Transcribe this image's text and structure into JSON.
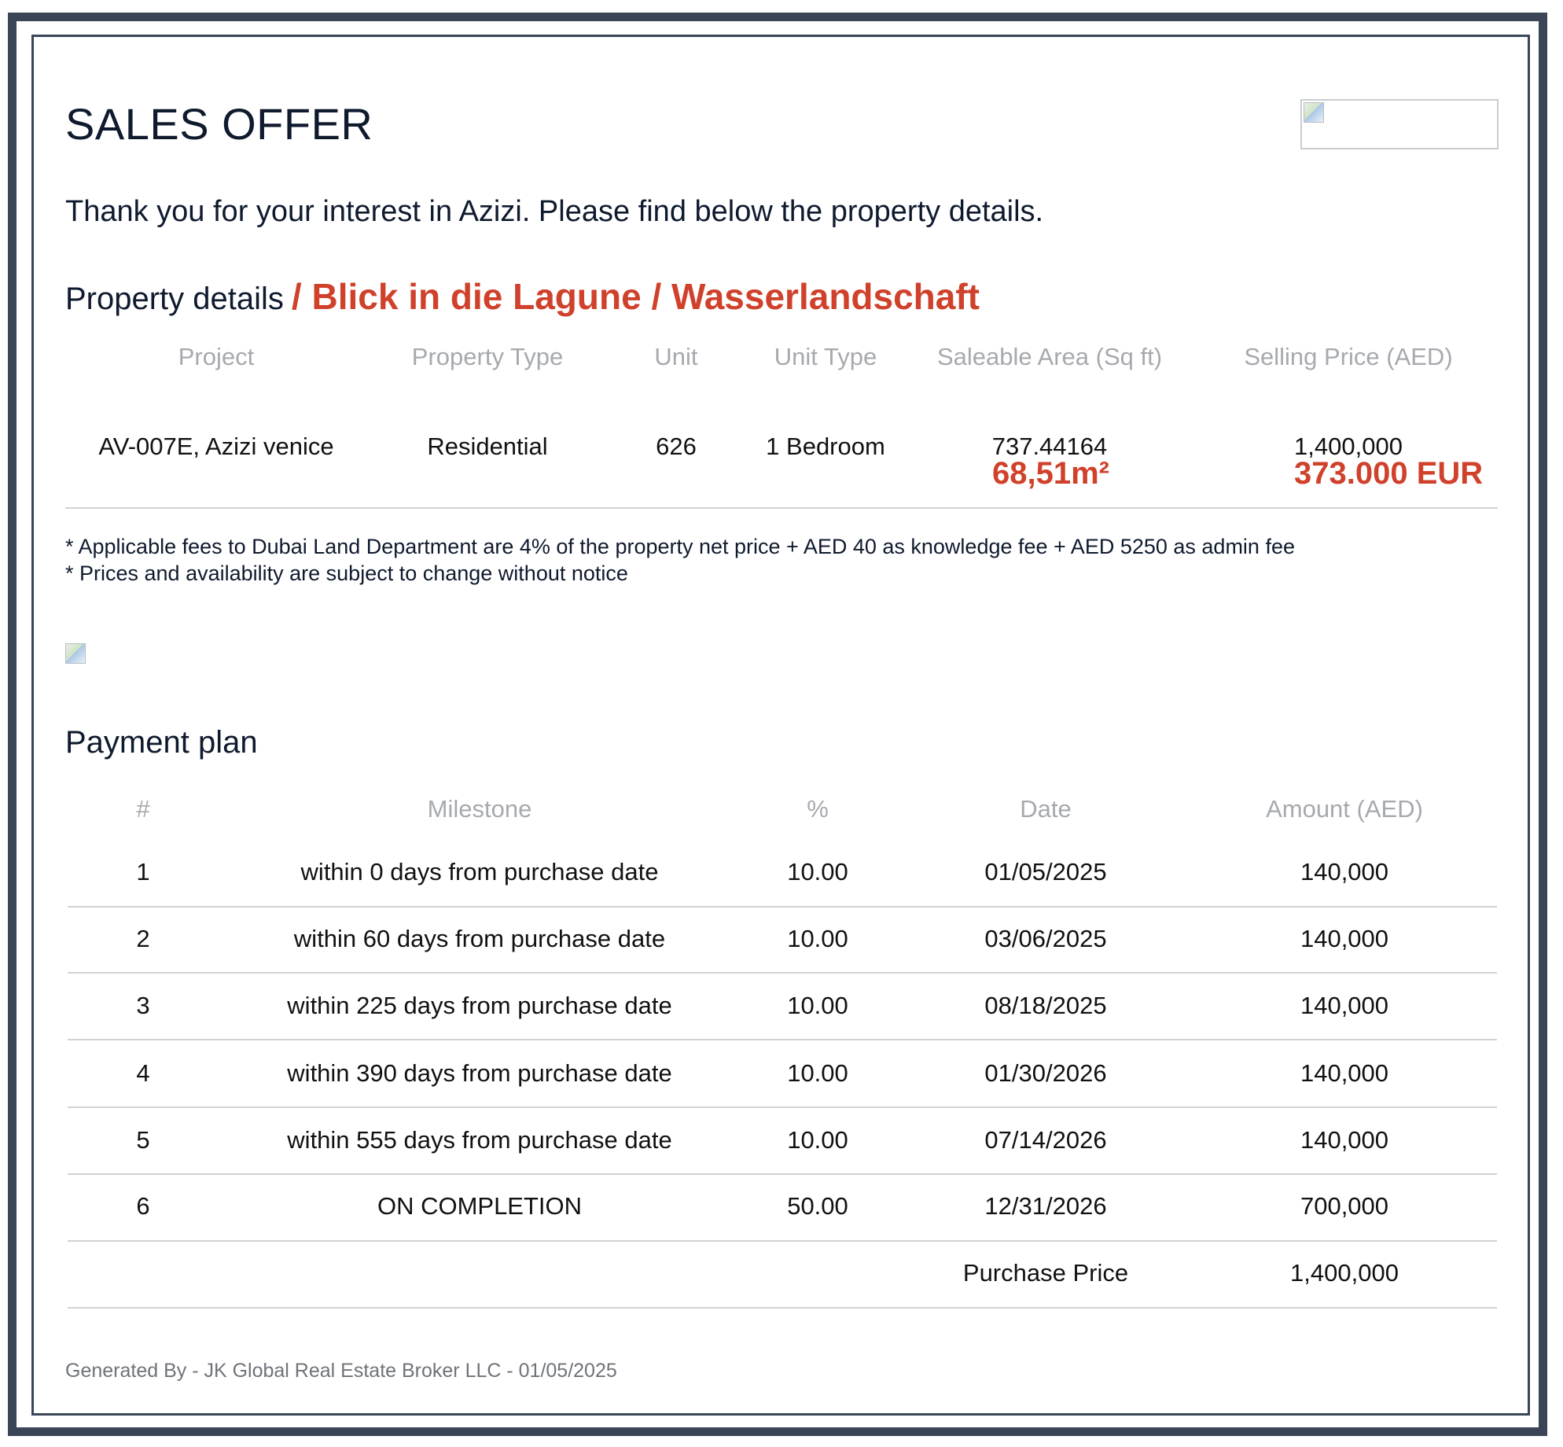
{
  "document": {
    "title": "SALES OFFER",
    "intro": "Thank you for your interest in Azizi. Please find below the property details."
  },
  "property": {
    "section_title": "Property details",
    "highlight": "/ Blick in die Lagune / Wasserlandschaft",
    "headers": [
      "Project",
      "Property Type",
      "Unit",
      "Unit Type",
      "Saleable Area (Sq ft)",
      "Selling Price (AED)"
    ],
    "row": [
      "AV-007E, Azizi venice",
      "Residential",
      "626",
      "1 Bedroom",
      "737.44164",
      "1,400,000"
    ],
    "area_note": "68,51m²",
    "price_note": "373.000 EUR"
  },
  "fees": {
    "line1": "* Applicable fees to Dubai Land Department are 4% of the property net price + AED 40 as knowledge fee + AED 5250 as admin fee",
    "line2": "* Prices and availability are subject to change without notice"
  },
  "payment_plan": {
    "title": "Payment plan",
    "headers": [
      "#",
      "Milestone",
      "%",
      "Date",
      "Amount (AED)"
    ],
    "rows": [
      [
        "1",
        "within 0 days from purchase date",
        "10.00",
        "01/05/2025",
        "140,000"
      ],
      [
        "2",
        "within 60 days from purchase date",
        "10.00",
        "03/06/2025",
        "140,000"
      ],
      [
        "3",
        "within 225 days from purchase date",
        "10.00",
        "08/18/2025",
        "140,000"
      ],
      [
        "4",
        "within 390 days from purchase date",
        "10.00",
        "01/30/2026",
        "140,000"
      ],
      [
        "5",
        "within 555 days from purchase date",
        "10.00",
        "07/14/2026",
        "140,000"
      ],
      [
        "6",
        "ON COMPLETION",
        "50.00",
        "12/31/2026",
        "700,000"
      ]
    ],
    "total_label": "Purchase Price",
    "total_value": "1,400,000"
  },
  "footer": {
    "text": "Generated By - JK Global Real Estate Broker LLC -  01/05/2025"
  }
}
